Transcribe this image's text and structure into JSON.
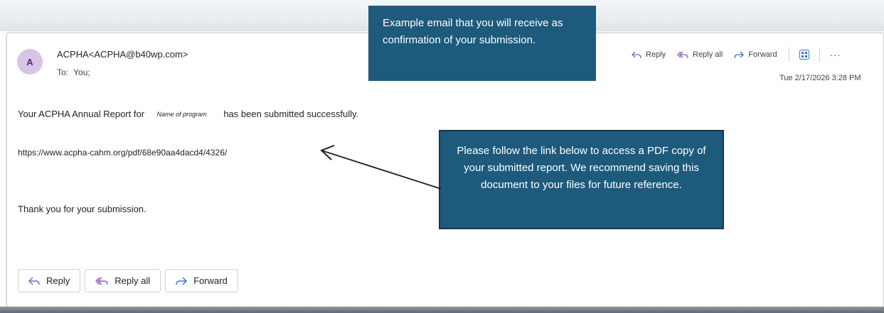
{
  "email": {
    "avatar_initial": "A",
    "sender": "ACPHA<ACPHA@b40wp.com>",
    "to_label": "To:",
    "to_value": "You;",
    "date": "Tue 2/17/2026 3:28 PM",
    "toolbar": {
      "reply": "Reply",
      "reply_all": "Reply all",
      "forward": "Forward",
      "more": "···"
    },
    "body": {
      "line1_before": "Your ACPHA Annual Report for",
      "program_name": "Name of program",
      "line1_after": "has been submitted successfully.",
      "link": "https://www.acpha-cahm.org/pdf/68e90aa4dacd4/4326/",
      "thanks": "Thank you for your submission."
    },
    "buttons": {
      "reply": "Reply",
      "reply_all": "Reply all",
      "forward": "Forward"
    }
  },
  "callouts": {
    "top": "Example email that you will receive as confirmation of your submission.",
    "middle": "Please follow the link below to access a PDF copy of your submitted report. We recommend saving this document to your files for future reference."
  },
  "colors": {
    "callout_bg": "#1d5a7c",
    "callout_border": "#14384d",
    "avatar_bg": "#d8c4e8",
    "icon_blue": "#2a78d0"
  },
  "icons": [
    "reply-icon",
    "reply-all-icon",
    "forward-icon",
    "apps-icon",
    "more-icon"
  ]
}
